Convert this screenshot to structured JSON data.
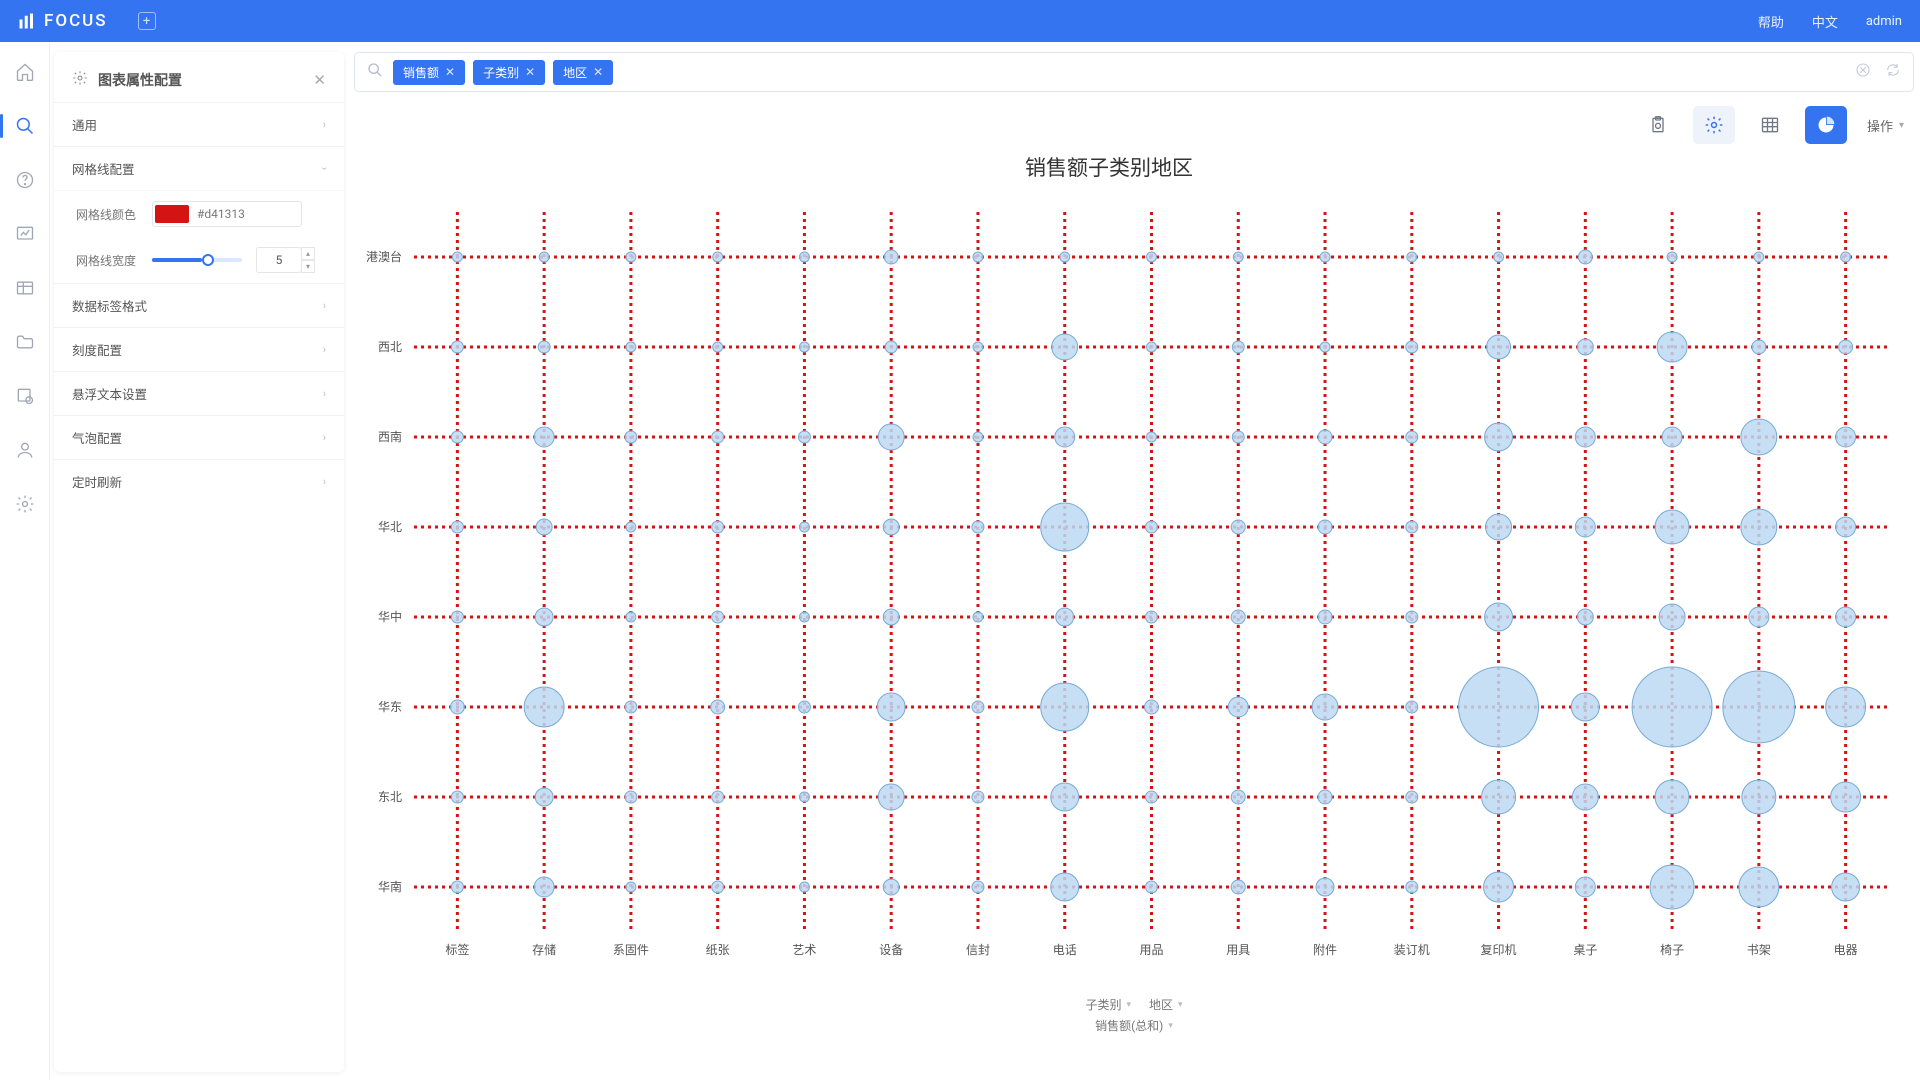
{
  "brand": "FOCUS",
  "topbar": {
    "help": "帮助",
    "lang": "中文",
    "user": "admin"
  },
  "panel": {
    "title": "图表属性配置",
    "sections": {
      "general": "通用",
      "gridline": "网格线配置",
      "datalabel": "数据标签格式",
      "scale": "刻度配置",
      "hover": "悬浮文本设置",
      "bubble": "气泡配置",
      "refresh": "定时刷新"
    },
    "gridcolor_label": "网格线颜色",
    "gridcolor_value": "#d41313",
    "gridwidth_label": "网格线宽度",
    "gridwidth_value": "5"
  },
  "search": {
    "tags": [
      "销售额",
      "子类别",
      "地区"
    ]
  },
  "toolbar": {
    "op": "操作"
  },
  "chart_title": "销售额子类别地区",
  "legend": {
    "a": "子类别",
    "b": "地区",
    "m": "销售额(总和)"
  },
  "chart_data": {
    "type": "scatter",
    "title": "销售额子类别地区",
    "xlabel": "子类别",
    "ylabel": "地区",
    "size_measure": "销售额(总和)",
    "x_categories": [
      "标签",
      "存储",
      "系固件",
      "纸张",
      "艺术",
      "设备",
      "信封",
      "电话",
      "用品",
      "用具",
      "附件",
      "装订机",
      "复印机",
      "桌子",
      "椅子",
      "书架",
      "电器"
    ],
    "y_categories": [
      "港澳台",
      "西北",
      "西南",
      "华北",
      "华中",
      "华东",
      "东北",
      "华南"
    ],
    "gridline_color": "#d41313",
    "bubble_fill": "#bcd9f2",
    "bubble_stroke": "#79a9d4",
    "size_values": [
      [
        5,
        5,
        5,
        5,
        5,
        7,
        5,
        5,
        5,
        5,
        5,
        5,
        5,
        7,
        5,
        5,
        5
      ],
      [
        6,
        6,
        5,
        5,
        5,
        6,
        5,
        13,
        5,
        6,
        5,
        6,
        12,
        8,
        15,
        7,
        7
      ],
      [
        6,
        10,
        6,
        6,
        6,
        13,
        5,
        10,
        5,
        6,
        7,
        6,
        14,
        10,
        10,
        18,
        10
      ],
      [
        6,
        8,
        5,
        6,
        5,
        8,
        6,
        24,
        6,
        7,
        7,
        6,
        13,
        10,
        17,
        18,
        10
      ],
      [
        6,
        9,
        5,
        6,
        5,
        8,
        5,
        9,
        6,
        7,
        7,
        6,
        14,
        8,
        13,
        10,
        10
      ],
      [
        7,
        20,
        6,
        7,
        6,
        14,
        6,
        24,
        7,
        10,
        13,
        6,
        40,
        14,
        40,
        36,
        20
      ],
      [
        6,
        9,
        6,
        6,
        5,
        13,
        6,
        14,
        6,
        7,
        7,
        6,
        17,
        13,
        17,
        17,
        15
      ],
      [
        6,
        10,
        5,
        6,
        5,
        8,
        6,
        14,
        6,
        7,
        9,
        6,
        15,
        10,
        22,
        20,
        14
      ]
    ]
  }
}
